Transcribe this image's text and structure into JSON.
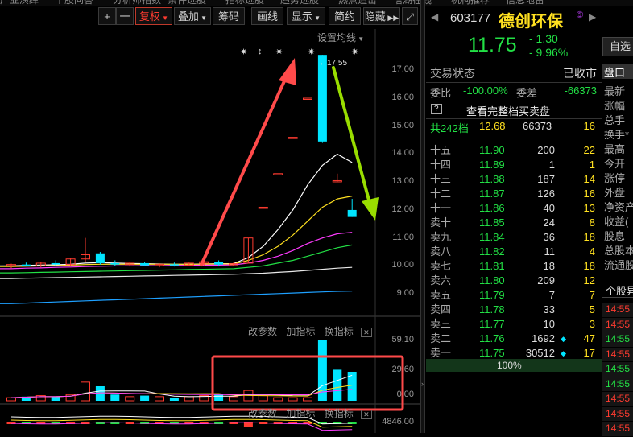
{
  "nav": {
    "cut_items": [
      "产业演绎",
      "个股问答",
      "分析师指数",
      "条件选股",
      "指标选股",
      "趋势选股",
      "热点追击",
      "信湖在线",
      "机构推荐",
      "信息地雷"
    ]
  },
  "toolbar": {
    "plus": "+",
    "minus": "一",
    "fuquan": "复权",
    "diejia": "叠加",
    "chouma": "筹码",
    "huaxian": "画线",
    "xianshi": "显示",
    "jianjie": "简约",
    "yincang": "隐藏"
  },
  "chart": {
    "settings_label": "设置均线",
    "last_price_label": "17.55",
    "y_ticks": [
      "17.00",
      "16.00",
      "15.00",
      "14.00",
      "13.00",
      "12.00",
      "11.00",
      "10.00",
      "9.00"
    ],
    "markers": [
      "✷",
      "↕",
      "✷",
      "✷",
      "✷"
    ],
    "indicator_controls": {
      "change": "改参数",
      "add": "加指标",
      "swap": "换指标",
      "close": "✕"
    },
    "vol_ticks": [
      "59.10",
      "29.60",
      "0.00"
    ],
    "macd_tick": "4846.00",
    "candles": [
      {
        "o": 10.02,
        "h": 10.08,
        "l": 9.92,
        "c": 10.05
      },
      {
        "o": 10.05,
        "h": 10.12,
        "l": 9.98,
        "c": 10.0
      },
      {
        "o": 10.0,
        "h": 10.15,
        "l": 9.95,
        "c": 10.1
      },
      {
        "o": 10.1,
        "h": 10.2,
        "l": 10.0,
        "c": 10.05
      },
      {
        "o": 10.05,
        "h": 10.3,
        "l": 10.0,
        "c": 10.25
      },
      {
        "o": 10.25,
        "h": 11.0,
        "l": 10.15,
        "c": 10.4
      },
      {
        "o": 10.45,
        "h": 10.5,
        "l": 10.05,
        "c": 10.1
      },
      {
        "o": 10.1,
        "h": 10.2,
        "l": 10.0,
        "c": 10.05
      },
      {
        "o": 10.05,
        "h": 10.12,
        "l": 9.98,
        "c": 10.1
      },
      {
        "o": 10.1,
        "h": 10.15,
        "l": 10.0,
        "c": 10.02
      },
      {
        "o": 10.02,
        "h": 10.1,
        "l": 9.95,
        "c": 10.06
      },
      {
        "o": 10.06,
        "h": 10.12,
        "l": 9.98,
        "c": 10.03
      },
      {
        "o": 10.03,
        "h": 10.12,
        "l": 10.0,
        "c": 10.1
      },
      {
        "o": 10.1,
        "h": 10.2,
        "l": 10.0,
        "c": 10.15
      },
      {
        "o": 10.15,
        "h": 10.2,
        "l": 10.0,
        "c": 10.05
      },
      {
        "o": 10.05,
        "h": 10.12,
        "l": 10.0,
        "c": 10.08
      },
      {
        "o": 10.1,
        "h": 11.0,
        "l": 10.1,
        "c": 11.0
      },
      {
        "o": 12.1,
        "h": 12.1,
        "l": 12.1,
        "c": 12.1
      },
      {
        "o": 13.3,
        "h": 13.3,
        "l": 13.3,
        "c": 13.3
      },
      {
        "o": 14.6,
        "h": 14.6,
        "l": 14.6,
        "c": 14.6
      },
      {
        "o": 16.0,
        "h": 16.0,
        "l": 16.0,
        "c": 16.0
      },
      {
        "o": 17.55,
        "h": 17.55,
        "l": 14.4,
        "c": 14.45
      },
      {
        "o": 13.05,
        "h": 13.3,
        "l": 13.0,
        "c": 13.05
      },
      {
        "o": 12.0,
        "h": 12.4,
        "l": 11.75,
        "c": 11.75
      }
    ],
    "ma_lines": [
      {
        "color": "#ffffff",
        "values": [
          10.0,
          10.02,
          10.03,
          10.04,
          10.06,
          10.1,
          10.12,
          10.1,
          10.09,
          10.08,
          10.07,
          10.06,
          10.06,
          10.07,
          10.08,
          10.08,
          10.3,
          10.7,
          11.3,
          12.0,
          12.9,
          13.6,
          14.0,
          13.7
        ]
      },
      {
        "color": "#ffe020",
        "values": [
          9.98,
          9.99,
          10.0,
          10.01,
          10.03,
          10.05,
          10.06,
          10.06,
          10.06,
          10.06,
          10.06,
          10.06,
          10.06,
          10.06,
          10.07,
          10.07,
          10.2,
          10.4,
          10.7,
          11.1,
          11.6,
          12.1,
          12.4,
          12.5
        ]
      },
      {
        "color": "#ff3bff",
        "values": [
          9.9,
          9.92,
          9.93,
          9.95,
          9.96,
          9.98,
          9.99,
          10.0,
          10.0,
          10.01,
          10.01,
          10.02,
          10.02,
          10.03,
          10.03,
          10.04,
          10.1,
          10.2,
          10.35,
          10.55,
          10.8,
          11.0,
          11.15,
          11.2
        ]
      },
      {
        "color": "#22e045",
        "values": [
          9.75,
          9.76,
          9.77,
          9.78,
          9.79,
          9.8,
          9.81,
          9.82,
          9.83,
          9.84,
          9.85,
          9.86,
          9.87,
          9.88,
          9.89,
          9.9,
          9.95,
          10.0,
          10.1,
          10.2,
          10.35,
          10.5,
          10.65,
          10.75
        ]
      },
      {
        "color": "#e8e8e8",
        "values": [
          9.55,
          9.56,
          9.57,
          9.58,
          9.59,
          9.6,
          9.61,
          9.62,
          9.63,
          9.64,
          9.65,
          9.66,
          9.67,
          9.68,
          9.69,
          9.7,
          9.72,
          9.74,
          9.77,
          9.8,
          9.84,
          9.88,
          9.92,
          9.95
        ]
      },
      {
        "color": "#1ea0ff",
        "values": [
          8.65,
          8.67,
          8.69,
          8.71,
          8.73,
          8.75,
          8.77,
          8.79,
          8.81,
          8.83,
          8.85,
          8.87,
          8.89,
          8.91,
          8.93,
          8.95,
          8.97,
          8.99,
          9.01,
          9.03,
          9.05,
          9.07,
          9.09,
          9.1
        ]
      }
    ],
    "volumes": [
      {
        "v": 3,
        "up": true
      },
      {
        "v": 4,
        "up": false
      },
      {
        "v": 5,
        "up": true
      },
      {
        "v": 4,
        "up": false
      },
      {
        "v": 6,
        "up": true
      },
      {
        "v": 18,
        "up": true
      },
      {
        "v": 14,
        "up": false
      },
      {
        "v": 6,
        "up": false
      },
      {
        "v": 4,
        "up": true
      },
      {
        "v": 5,
        "up": false
      },
      {
        "v": 4,
        "up": true
      },
      {
        "v": 3,
        "up": false
      },
      {
        "v": 4,
        "up": true
      },
      {
        "v": 5,
        "up": true
      },
      {
        "v": 6,
        "up": false
      },
      {
        "v": 4,
        "up": true
      },
      {
        "v": 10,
        "up": true
      },
      {
        "v": 5,
        "up": true
      },
      {
        "v": 3,
        "up": true
      },
      {
        "v": 3,
        "up": true
      },
      {
        "v": 3,
        "up": true
      },
      {
        "v": 59.1,
        "up": false
      },
      {
        "v": 30,
        "up": false
      },
      {
        "v": 28,
        "up": false
      }
    ]
  },
  "stock": {
    "code": "603177",
    "name": "德创环保",
    "tag": "⑤",
    "price": "11.75",
    "change": "- 1.30",
    "change_pct": "- 9.96%",
    "watch_btn": "自选"
  },
  "summary": {
    "status_label": "交易状态",
    "status_value": "已收市",
    "ratio_label": "委比",
    "ratio_value": "-100.00%",
    "diff_label": "委差",
    "diff_value": "-66373",
    "full_book_icon": "?",
    "full_book_text": "查看完整档买卖盘",
    "total_label": "共242档",
    "total_price": "12.68",
    "total_vol": "66373",
    "total_count": "16"
  },
  "orderbook": [
    {
      "label": "十五",
      "price": "11.90",
      "vol": "200",
      "count": "22"
    },
    {
      "label": "十四",
      "price": "11.89",
      "vol": "1",
      "count": "1"
    },
    {
      "label": "十三",
      "price": "11.88",
      "vol": "187",
      "count": "14"
    },
    {
      "label": "十二",
      "price": "11.87",
      "vol": "126",
      "count": "16"
    },
    {
      "label": "十一",
      "price": "11.86",
      "vol": "40",
      "count": "13"
    },
    {
      "label": "卖十",
      "price": "11.85",
      "vol": "24",
      "count": "8"
    },
    {
      "label": "卖九",
      "price": "11.84",
      "vol": "36",
      "count": "18"
    },
    {
      "label": "卖八",
      "price": "11.82",
      "vol": "11",
      "count": "4"
    },
    {
      "label": "卖七",
      "price": "11.81",
      "vol": "18",
      "count": "18"
    },
    {
      "label": "卖六",
      "price": "11.80",
      "vol": "209",
      "count": "12"
    },
    {
      "label": "卖五",
      "price": "11.79",
      "vol": "7",
      "count": "7"
    },
    {
      "label": "卖四",
      "price": "11.78",
      "vol": "33",
      "count": "5"
    },
    {
      "label": "卖三",
      "price": "11.77",
      "vol": "10",
      "count": "3"
    },
    {
      "label": "卖二",
      "price": "11.76",
      "vol": "1692",
      "count": "47"
    },
    {
      "label": "卖一",
      "price": "11.75",
      "vol": "30512",
      "count": "17"
    }
  ],
  "progress": {
    "label": "100%",
    "value": 1.0
  },
  "side_panel": {
    "tab": "盘口",
    "items": [
      "最新",
      "涨幅",
      "总手",
      "换手*",
      "最高",
      "今开",
      "涨停",
      "外盘",
      "净资产",
      "收益(",
      "股息",
      "总股本",
      "流通股"
    ],
    "section": "个股异"
  },
  "ticks": [
    {
      "time": "14:55",
      "color": "#ff3b30"
    },
    {
      "time": "14:55",
      "color": "#ff3b30"
    },
    {
      "time": "14:55",
      "color": "#22e045"
    },
    {
      "time": "14:55",
      "color": "#ff3b30"
    },
    {
      "time": "14:55",
      "color": "#22e045"
    },
    {
      "time": "14:55",
      "color": "#22e045"
    },
    {
      "time": "14:55",
      "color": "#ff3b30"
    },
    {
      "time": "14:55",
      "color": "#ff3b30"
    },
    {
      "time": "14:55",
      "color": "#ff3b30"
    }
  ],
  "colors": {
    "up": "#ff3b30",
    "down": "#00e5ff",
    "green": "#22e045",
    "yellow": "#ffe020",
    "annot_red": "#ff4a4a",
    "annot_green": "#99dd00"
  }
}
